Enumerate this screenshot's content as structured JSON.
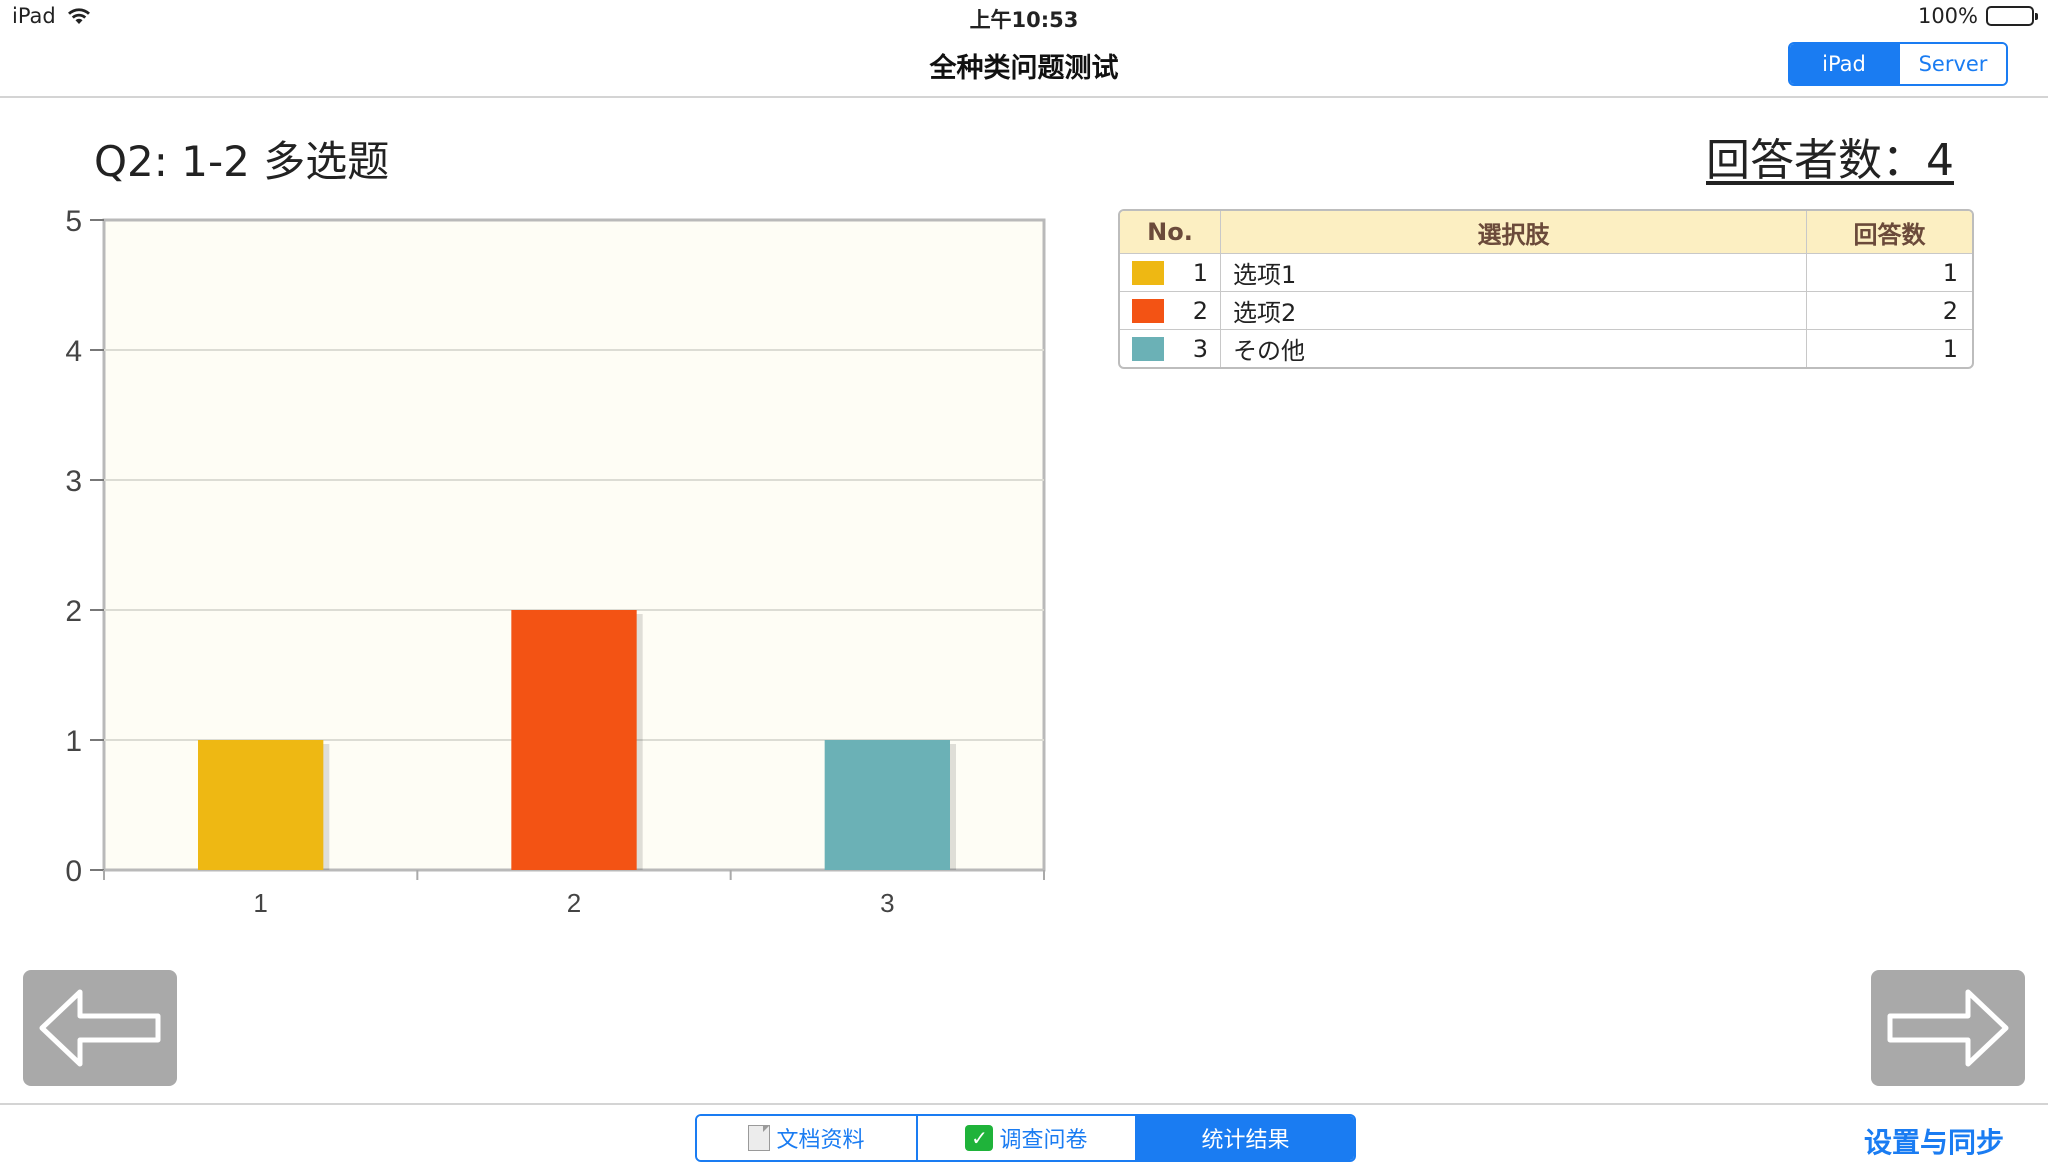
{
  "status": {
    "device": "iPad",
    "time": "上午10:53",
    "battery": "100%",
    "battery_level": 1.0
  },
  "nav": {
    "title": "全种类问题测试",
    "segments": [
      {
        "label": "iPad",
        "active": true
      },
      {
        "label": "Server",
        "active": false
      }
    ]
  },
  "question": {
    "title": "Q2: 1-2 多选题",
    "respondents": "回答者数：4"
  },
  "chart_data": {
    "type": "bar",
    "categories": [
      "1",
      "2",
      "3"
    ],
    "values": [
      1,
      2,
      1
    ],
    "colors": [
      "#EEB813",
      "#F35314",
      "#6BB1B6"
    ],
    "title": "",
    "xlabel": "",
    "ylabel": "",
    "ylim": [
      0,
      5
    ],
    "yticks": [
      "0",
      "1",
      "2",
      "3",
      "4",
      "5"
    ],
    "grid": true,
    "plot_background": "#FEFDF5"
  },
  "table": {
    "headers": [
      "No.",
      "選択肢",
      "回答数"
    ],
    "rows": [
      {
        "no": "1",
        "color": "#EEB813",
        "option": "选项1",
        "count": "1"
      },
      {
        "no": "2",
        "color": "#F35314",
        "option": "选项2",
        "count": "2"
      },
      {
        "no": "3",
        "color": "#6BB1B6",
        "option": "その他",
        "count": "1"
      }
    ]
  },
  "toolbar": {
    "tabs": [
      {
        "label": "文档资料",
        "icon": "document-icon",
        "active": false
      },
      {
        "label": "调查问卷",
        "icon": "checkbox-icon",
        "active": false
      },
      {
        "label": "统计结果",
        "icon": "",
        "active": true
      }
    ],
    "settings_label": "设置与同步"
  },
  "colors": {
    "accent": "#1A7CF2",
    "table_header_bg": "#FCEFC2",
    "arrow_button_bg": "#A9A9A9"
  }
}
